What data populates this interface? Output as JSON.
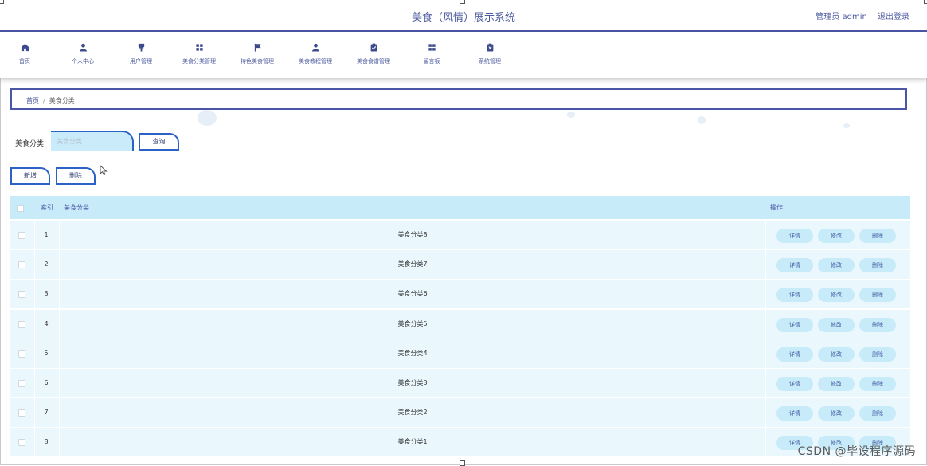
{
  "header": {
    "title": "美食（风情）展示系统",
    "admin_label": "管理员 admin",
    "logout_label": "退出登录"
  },
  "nav": {
    "items": [
      {
        "label": "首页",
        "icon": "home-icon"
      },
      {
        "label": "个人中心",
        "icon": "user-icon"
      },
      {
        "label": "用户管理",
        "icon": "brush-icon"
      },
      {
        "label": "美食分类管理",
        "icon": "grid-icon"
      },
      {
        "label": "特色美食管理",
        "icon": "flag-icon"
      },
      {
        "label": "美食教程管理",
        "icon": "user-icon"
      },
      {
        "label": "美食食谱管理",
        "icon": "clipboard-check-icon"
      },
      {
        "label": "留言板",
        "icon": "grid-icon"
      },
      {
        "label": "系统管理",
        "icon": "clipboard-x-icon"
      }
    ]
  },
  "breadcrumb": {
    "home": "首页",
    "separator": "/",
    "current": "美食分类"
  },
  "search": {
    "label": "美食分类",
    "placeholder": "美食分类",
    "value": "",
    "button": "查询"
  },
  "actions": {
    "add": "新增",
    "delete": "删除"
  },
  "table": {
    "headers": {
      "index": "索引",
      "name": "美食分类",
      "operation": "操作"
    },
    "row_buttons": {
      "detail": "详情",
      "edit": "修改",
      "delete": "删除"
    },
    "rows": [
      {
        "index": "1",
        "name": "美食分类8"
      },
      {
        "index": "2",
        "name": "美食分类7"
      },
      {
        "index": "3",
        "name": "美食分类6"
      },
      {
        "index": "4",
        "name": "美食分类5"
      },
      {
        "index": "5",
        "name": "美食分类4"
      },
      {
        "index": "6",
        "name": "美食分类3"
      },
      {
        "index": "7",
        "name": "美食分类2"
      },
      {
        "index": "8",
        "name": "美食分类1"
      }
    ]
  },
  "watermark": "CSDN @毕设程序源码",
  "colors": {
    "accent": "#4a56a6",
    "button_border": "#2a62c8",
    "table_header_bg": "#c8ebfa",
    "table_row_bg": "#eaf8fe"
  }
}
